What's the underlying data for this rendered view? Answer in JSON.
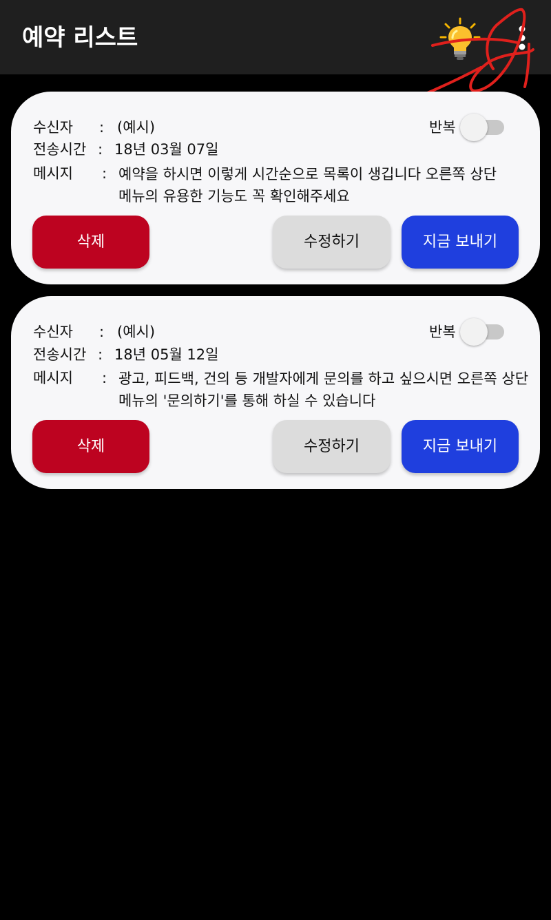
{
  "appbar": {
    "title": "예약 리스트",
    "tips_icon": "lightbulb-icon",
    "menu_icon": "more-vertical-icon"
  },
  "labels": {
    "recipient": "수신자",
    "send_time": "전송시간",
    "message": "메시지",
    "colon": ":",
    "repeat": "반복"
  },
  "reservations": [
    {
      "recipient": "(예시)",
      "send_time": "18년 03월 07일",
      "message_lines": [
        "예약을 하시면 이렇게 시간순으로 목록이 생깁니다 오른쪽 상단",
        "메뉴의 유용한 기능도 꼭 확인해주세요"
      ],
      "repeat_on": false,
      "delete_label": "삭제",
      "edit_label": "수정하기",
      "send_label": "지금 보내기"
    },
    {
      "recipient": "(예시)",
      "send_time": "18년 05월 12일",
      "message_lines": [
        "광고, 피드백, 건의 등 개발자에게 문의를 하고 싶으시면 오른쪽 상단",
        "메뉴의 '문의하기'를 통해 하실 수 있습니다"
      ],
      "repeat_on": false,
      "delete_label": "삭제",
      "edit_label": "수정하기",
      "send_label": "지금 보내기"
    }
  ],
  "colors": {
    "background": "#000000",
    "appbar": "#1f1f1f",
    "card": "#f7f7f9",
    "delete_button": "#bd0320",
    "edit_button": "#dcdcdc",
    "send_button": "#1f3fde",
    "annotation": "#e0201c"
  }
}
